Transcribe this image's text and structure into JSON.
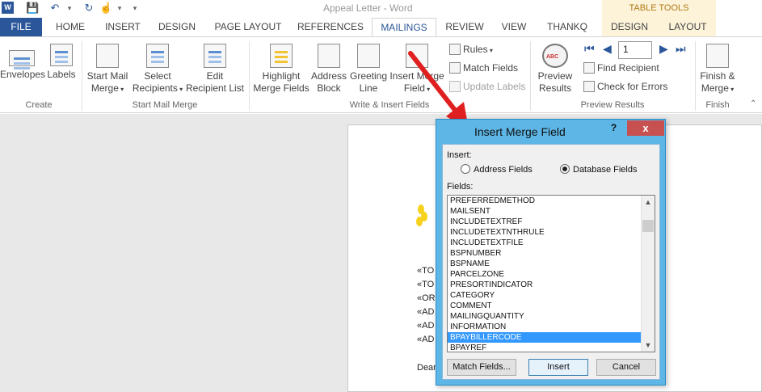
{
  "window": {
    "title": "Appeal Letter - Word",
    "table_tools_label": "TABLE TOOLS"
  },
  "tabs": {
    "file": "FILE",
    "home": "HOME",
    "insert": "INSERT",
    "design": "DESIGN",
    "page_layout": "PAGE LAYOUT",
    "references": "REFERENCES",
    "mailings": "MAILINGS",
    "review": "REVIEW",
    "view": "VIEW",
    "thankq": "THANKQ",
    "table_design": "DESIGN",
    "table_layout": "LAYOUT"
  },
  "ribbon": {
    "create": {
      "label": "Create",
      "envelopes": "Envelopes",
      "labels": "Labels"
    },
    "start_mail_merge": {
      "label": "Start Mail Merge",
      "start_line1": "Start Mail",
      "start_line2": "Merge",
      "select_line1": "Select",
      "select_line2": "Recipients",
      "edit_line1": "Edit",
      "edit_line2": "Recipient List"
    },
    "write_insert": {
      "label": "Write & Insert Fields",
      "highlight_line1": "Highlight",
      "highlight_line2": "Merge Fields",
      "address_line1": "Address",
      "address_line2": "Block",
      "greeting_line1": "Greeting",
      "greeting_line2": "Line",
      "insert_line1": "Insert Merge",
      "insert_line2": "Field",
      "rules": "Rules",
      "match_fields": "Match Fields",
      "update_labels": "Update Labels"
    },
    "preview": {
      "label": "Preview Results",
      "preview_line1": "Preview",
      "preview_line2": "Results",
      "record_value": "1",
      "find_recipient": "Find Recipient",
      "check_errors": "Check for Errors"
    },
    "finish": {
      "label": "Finish",
      "line1": "Finish &",
      "line2": "Merge"
    }
  },
  "document": {
    "lines": [
      "«TO",
      "«TO",
      "«OR",
      "«AD",
      "«AD",
      "«AD"
    ],
    "greeting": "Dear"
  },
  "dialog": {
    "title": "Insert Merge Field",
    "help": "?",
    "close": "x",
    "insert_label": "Insert:",
    "radio_address": "Address Fields",
    "radio_database": "Database Fields",
    "selected_radio": "database",
    "fields_label": "Fields:",
    "fields": [
      "PREFERREDMETHOD",
      "MAILSENT",
      "INCLUDETEXTREF",
      "INCLUDETEXTNTHRULE",
      "INCLUDETEXTFILE",
      "BSPNUMBER",
      "BSPNAME",
      "PARCELZONE",
      "PRESORTINDICATOR",
      "CATEGORY",
      "COMMENT",
      "MAILINGQUANTITY",
      "INFORMATION",
      "BPAYBILLERCODE",
      "BPAYREF"
    ],
    "selected_field": "BPAYBILLERCODE",
    "match_fields_button": "Match Fields...",
    "insert_button": "Insert",
    "cancel_button": "Cancel"
  },
  "colors": {
    "accent": "#2b579a",
    "dialog_frame": "#5db6e5",
    "selection": "#3399ff",
    "close": "#c75050",
    "annotation_arrow": "#e02020"
  }
}
